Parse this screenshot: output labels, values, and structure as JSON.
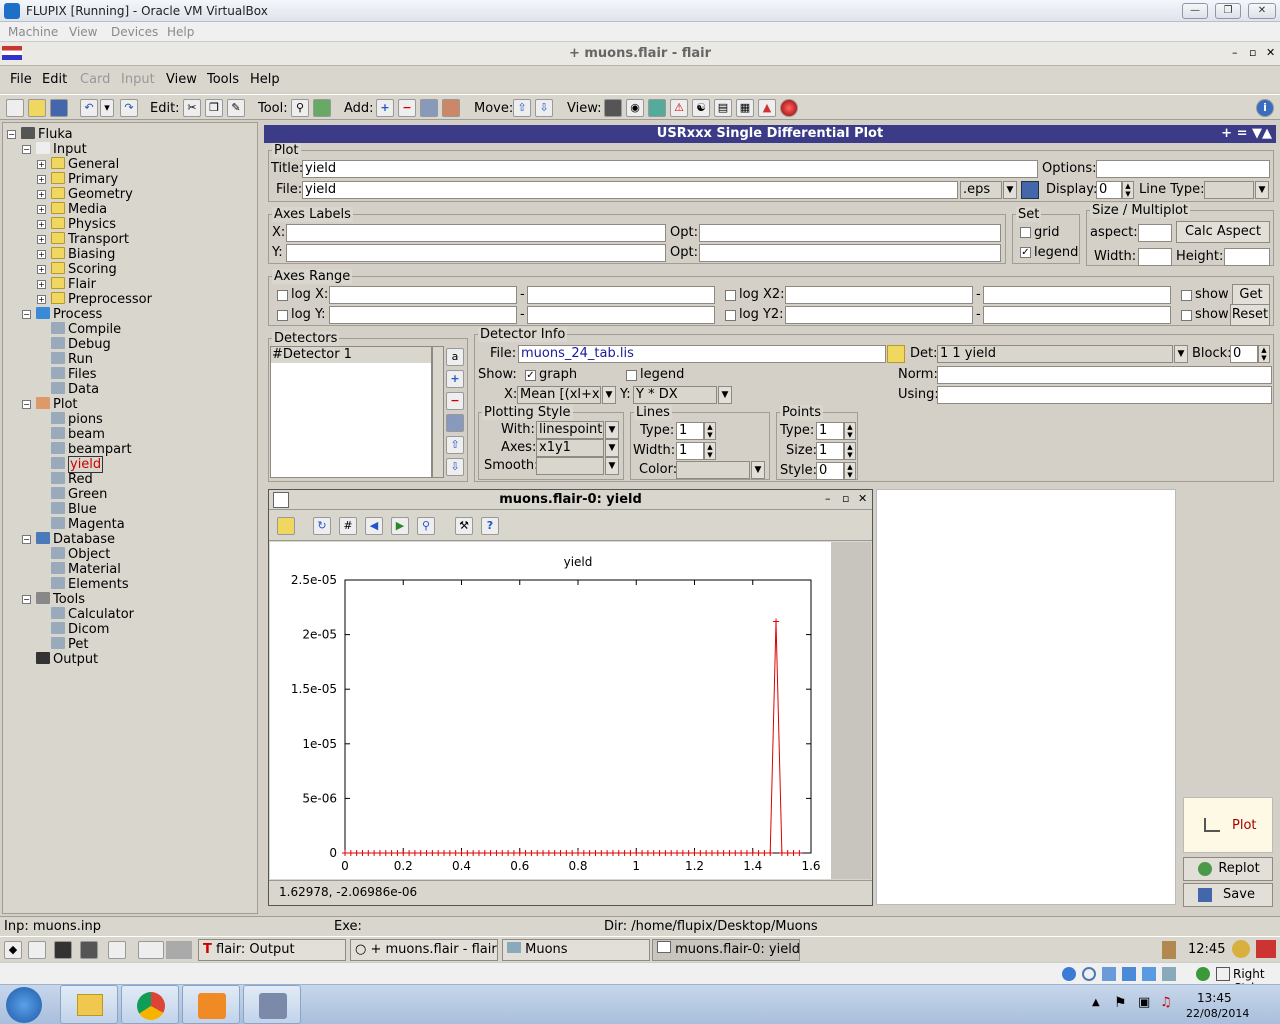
{
  "vbox": {
    "title": "FLUPIX [Running] - Oracle VM VirtualBox",
    "menu": [
      "Machine",
      "View",
      "Devices",
      "Help"
    ],
    "host_key": "Right Ctrl"
  },
  "app": {
    "title": "+ muons.flair - flair",
    "menu": [
      "File",
      "Edit",
      "Card",
      "Input",
      "View",
      "Tools",
      "Help"
    ],
    "toolbar_labels": {
      "edit": "Edit:",
      "tool": "Tool:",
      "add": "Add:",
      "move": "Move:",
      "view": "View:"
    }
  },
  "tree": {
    "root": "Fluka",
    "input": "Input",
    "input_children": [
      "General",
      "Primary",
      "Geometry",
      "Media",
      "Physics",
      "Transport",
      "Biasing",
      "Scoring",
      "Flair",
      "Preprocessor"
    ],
    "process": "Process",
    "process_children": [
      "Compile",
      "Debug",
      "Run",
      "Files",
      "Data"
    ],
    "plot": "Plot",
    "plot_children": [
      "pions",
      "beam",
      "beampart",
      "yield",
      "Red",
      "Green",
      "Blue",
      "Magenta"
    ],
    "database": "Database",
    "database_children": [
      "Object",
      "Material",
      "Elements"
    ],
    "tools": "Tools",
    "tools_children": [
      "Calculator",
      "Dicom",
      "Pet"
    ],
    "output": "Output"
  },
  "panel": {
    "header": "USRxxx Single Differential Plot",
    "header_controls": "+ = ▼▲",
    "plot_group": "Plot",
    "title_label": "Title:",
    "title_value": "yield",
    "options_label": "Options:",
    "options_value": "",
    "file_label": "File:",
    "file_value": "yield",
    "file_ext": ".eps",
    "display_label": "Display:",
    "display_value": "0",
    "linetype_label": "Line Type:",
    "axes_labels_group": "Axes Labels",
    "x_label": "X:",
    "y_label": "Y:",
    "opt_label": "Opt:",
    "set_group": "Set",
    "grid_label": "grid",
    "legend_label": "legend",
    "size_group": "Size / Multiplot",
    "aspect_label": "aspect:",
    "calc_aspect": "Calc Aspect",
    "width_label": "Width:",
    "height_label": "Height:",
    "axes_range_group": "Axes Range",
    "logx": "log X:",
    "logy": "log Y:",
    "logx2": "log X2:",
    "logy2": "log Y2:",
    "dash": "-",
    "show": "show",
    "get": "Get",
    "reset": "Reset",
    "detectors_group": "Detectors",
    "detector_item": "#Detector 1",
    "detector_info_group": "Detector Info",
    "di_file_label": "File:",
    "di_file_value": "muons_24_tab.lis",
    "det_label": "Det:",
    "det_value": "1 1  yield",
    "block_label": "Block:",
    "block_value": "0",
    "show_label": "Show:",
    "graph_label": "graph",
    "di_legend_label": "legend",
    "norm_label": "Norm:",
    "using_label": "Using:",
    "x_sel_label": "X:",
    "x_sel_value": "Mean [(xl+xh",
    "y_sel_label": "Y:",
    "y_sel_value": "Y * DX",
    "plotting_style_group": "Plotting Style",
    "with_label": "With:",
    "with_value": "linespoints",
    "axes_label": "Axes:",
    "axes_value": "x1y1",
    "smooth_label": "Smooth:",
    "lines_group": "Lines",
    "type_label": "Type:",
    "lines_type": "1",
    "width_label2": "Width:",
    "lines_width": "1",
    "color_label": "Color:",
    "points_group": "Points",
    "points_type": "1",
    "size_label": "Size:",
    "points_size": "1",
    "style_label": "Style:",
    "points_style": "0",
    "plot_btn": "Plot",
    "replot_btn": "Replot",
    "save_btn": "Save"
  },
  "plotwin": {
    "title": "muons.flair-0: yield",
    "coords": "1.62978, -2.06986e-06"
  },
  "chart_data": {
    "type": "line",
    "title": "yield",
    "xlabel": "",
    "ylabel": "",
    "xlim": [
      0,
      1.6
    ],
    "ylim": [
      0,
      2.5e-05
    ],
    "x_ticks": [
      "0",
      "0.2",
      "0.4",
      "0.6",
      "0.8",
      "1",
      "1.2",
      "1.4",
      "1.6"
    ],
    "y_ticks": [
      "0",
      "5e-06",
      "1e-05",
      "1.5e-05",
      "2e-05",
      "2.5e-05"
    ],
    "series": [
      {
        "color": "#e00000",
        "x": [
          0.0,
          0.02,
          0.04,
          0.06,
          0.08,
          0.1,
          0.12,
          0.14,
          0.16,
          0.18,
          0.2,
          0.22,
          0.24,
          0.26,
          0.28,
          0.3,
          0.32,
          0.34,
          0.36,
          0.38,
          0.4,
          0.42,
          0.44,
          0.46,
          0.48,
          0.5,
          0.52,
          0.54,
          0.56,
          0.58,
          0.6,
          0.62,
          0.64,
          0.66,
          0.68,
          0.7,
          0.72,
          0.74,
          0.76,
          0.78,
          0.8,
          0.82,
          0.84,
          0.86,
          0.88,
          0.9,
          0.92,
          0.94,
          0.96,
          0.98,
          1.0,
          1.02,
          1.04,
          1.06,
          1.08,
          1.1,
          1.12,
          1.14,
          1.16,
          1.18,
          1.2,
          1.22,
          1.24,
          1.26,
          1.28,
          1.3,
          1.32,
          1.34,
          1.36,
          1.38,
          1.4,
          1.42,
          1.44,
          1.46,
          1.48,
          1.5,
          1.52,
          1.54,
          1.56
        ],
        "y": [
          0,
          0,
          0,
          0,
          0,
          0,
          0,
          0,
          0,
          0,
          0,
          0,
          0,
          0,
          0,
          0,
          0,
          0,
          0,
          0,
          0,
          0,
          0,
          0,
          0,
          0,
          0,
          0,
          0,
          0,
          0,
          0,
          0,
          0,
          0,
          0,
          0,
          0,
          0,
          0,
          0,
          0,
          0,
          0,
          0,
          0,
          0,
          0,
          0,
          0,
          0,
          0,
          0,
          0,
          0,
          0,
          0,
          0,
          0,
          0,
          0,
          0,
          0,
          0,
          0,
          0,
          0,
          0,
          0,
          0,
          0,
          0,
          0,
          0,
          2.12e-05,
          0,
          0,
          0,
          0
        ]
      }
    ]
  },
  "status": {
    "inp": "Inp: muons.inp",
    "exe": "Exe:",
    "dir": "Dir: /home/flupix/Desktop/Muons"
  },
  "taskbar": {
    "tasks": [
      "flair: Output",
      "+ muons.flair - flair",
      "Muons",
      "muons.flair-0: yield"
    ],
    "clock": "12:45"
  },
  "win": {
    "time": "13:45",
    "date": "22/08/2014"
  }
}
